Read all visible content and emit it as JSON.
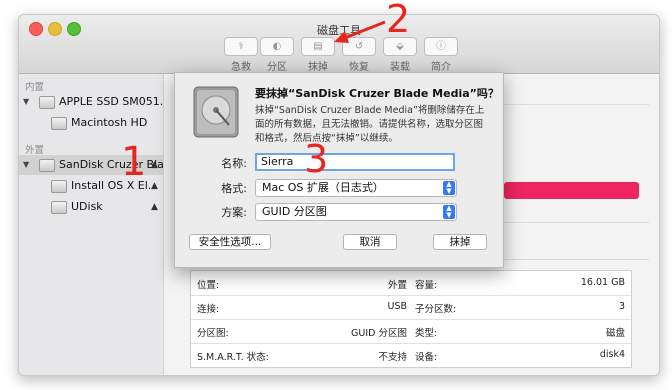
{
  "window": {
    "title": "磁盘工具"
  },
  "toolbar": {
    "buttons": [
      {
        "label": "急救",
        "icon": "stethoscope-icon",
        "glyph": "⚕"
      },
      {
        "label": "分区",
        "icon": "partition-icon",
        "glyph": "◐"
      },
      {
        "label": "抹掉",
        "icon": "erase-icon",
        "glyph": "▤"
      },
      {
        "label": "恢复",
        "icon": "restore-icon",
        "glyph": "↺"
      },
      {
        "label": "装载",
        "icon": "mount-icon",
        "glyph": "⬙"
      },
      {
        "label": "简介",
        "icon": "info-icon",
        "glyph": "ⓘ"
      }
    ]
  },
  "sidebar": {
    "internal_header": "内置",
    "external_header": "外置",
    "internal": [
      {
        "label": "APPLE SSD SM051...",
        "level": 0,
        "expanded": true
      },
      {
        "label": "Macintosh HD",
        "level": 1
      }
    ],
    "external": [
      {
        "label": "SanDisk Cruzer Bla...",
        "level": 0,
        "expanded": true,
        "selected": true,
        "eject": "▲"
      },
      {
        "label": "Install OS X El...",
        "level": 1,
        "eject": "▲"
      },
      {
        "label": "UDisk",
        "level": 1,
        "eject": "▲"
      }
    ]
  },
  "dialog": {
    "title": "要抹掉“SanDisk Cruzer Blade Media”吗？",
    "description": "抹掉“SanDisk Cruzer Blade Media”将删除储存在上面的所有数据，且无法撤销。请提供名称，选取分区图和格式，然后点按“抹掉”以继续。",
    "name_label": "名称:",
    "name_value": "Sierra",
    "format_label": "格式:",
    "format_value": "Mac OS 扩展（日志式）",
    "scheme_label": "方案:",
    "scheme_value": "GUID 分区图",
    "security_button": "安全性选项...",
    "cancel_button": "取消",
    "erase_button": "抹掉"
  },
  "info_table": {
    "rows": [
      {
        "k1": "位置:",
        "v1": "外置",
        "k2": "容量:",
        "v2": "16.01 GB"
      },
      {
        "k1": "连接:",
        "v1": "USB",
        "k2": "子分区数:",
        "v2": "3"
      },
      {
        "k1": "分区图:",
        "v1": "GUID 分区图",
        "k2": "类型:",
        "v2": "磁盘"
      },
      {
        "k1": "S.M.A.R.T. 状态:",
        "v1": "不支持",
        "k2": "设备:",
        "v2": "disk4"
      }
    ]
  },
  "annotations": {
    "one": "1",
    "two": "2",
    "three": "3"
  },
  "colors": {
    "accent": "#3478f6",
    "annotation": "#e8261f",
    "usage_bar": "#ee2560",
    "focus_ring": "#6aa5ee"
  }
}
